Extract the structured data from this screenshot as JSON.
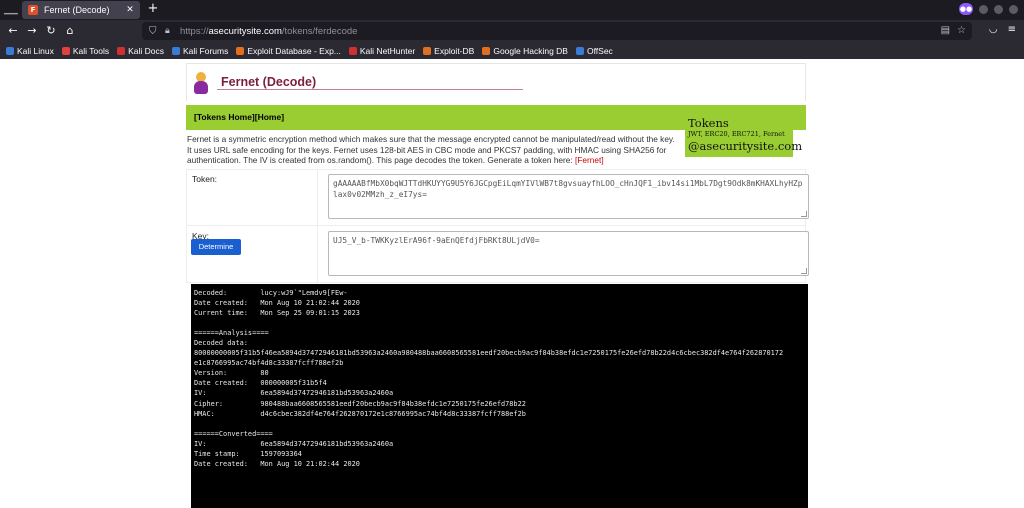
{
  "browser": {
    "tab_title": "Fernet (Decode)",
    "url_prefix": "https://",
    "url_host": "asecuritysite.com",
    "url_path": "/tokens/ferdecode",
    "bookmarks": [
      {
        "label": "Kali Linux",
        "color": "#3a7bd5"
      },
      {
        "label": "Kali Tools",
        "color": "#e04040"
      },
      {
        "label": "Kali Docs",
        "color": "#d03030"
      },
      {
        "label": "Kali Forums",
        "color": "#3a7bd5"
      },
      {
        "label": "Exploit Database - Exp...",
        "color": "#e07020"
      },
      {
        "label": "Kali NetHunter",
        "color": "#d03030"
      },
      {
        "label": "Exploit-DB",
        "color": "#e07020"
      },
      {
        "label": "Google Hacking DB",
        "color": "#e07020"
      },
      {
        "label": "OffSec",
        "color": "#3a7bd5"
      }
    ]
  },
  "page": {
    "title": "Fernet (Decode)",
    "nav": "[Tokens Home][Home]",
    "tokens_box": {
      "title": "Tokens",
      "subtitle": "JWT, ERC20, ERC721, Fernet",
      "site": "@asecuritysite.com"
    },
    "description": "Fernet is a symmetric encryption method which makes sure that the message encrypted cannot be manipulated/read without the key. It uses URL safe encoding for the keys. Fernet uses 128-bit AES in CBC mode and PKCS7 padding, with HMAC using SHA256 for authentication. The IV is created from os.random(). This page decodes the token. Generate a token here: ",
    "description_link": "[Fernet]",
    "token_label": "Token:",
    "token_value": "gAAAAABfMbX0bqWJTTdHKUYYG9U5Y6JGCpgEiLqmYIVlWB7t8gvsuayfhLOO_cHnJQF1_ibv14si1MbL7Dgt9Odk8mKHAXLhyHZplax0v02MMzh_z_eI7ys=",
    "key_label": "Key:",
    "key_value": "UJ5_V_b-TWKKyzlErA96f-9aEnQEfdjFbRKt8ULjdV0=",
    "determine_button": "Determine",
    "output_lines": [
      "Decoded:        lucy:wJ9`\"Lemdv9[FEw-",
      "Date created:   Mon Aug 10 21:02:44 2020",
      "Current time:   Mon Sep 25 09:01:15 2023",
      "",
      "======Analysis====",
      "Decoded data:",
      "80000000005f31b5f46ea5894d37472946181bd53963a2460a980488baa6608565581eedf20becb9ac9f84b38efdc1e7250175fe26efd78b22d4c6cbec382df4e764f262870172",
      "e1c8766995ac74bf4d8c33387fcff788ef2b",
      "Version:        80",
      "Date created:   000000005f31b5f4",
      "IV:             6ea5894d37472946181bd53963a2460a",
      "Cipher:         980488baa6608565581eedf20becb9ac9f84b38efdc1e7250175fe26efd78b22",
      "HMAC:           d4c6cbec382df4e764f262870172e1c8766995ac74bf4d8c33387fcff788ef2b",
      "",
      "======Converted====",
      "IV:             6ea5894d37472946181bd53963a2460a",
      "Time stamp:     1597093364",
      "Date created:   Mon Aug 10 21:02:44 2020"
    ]
  }
}
